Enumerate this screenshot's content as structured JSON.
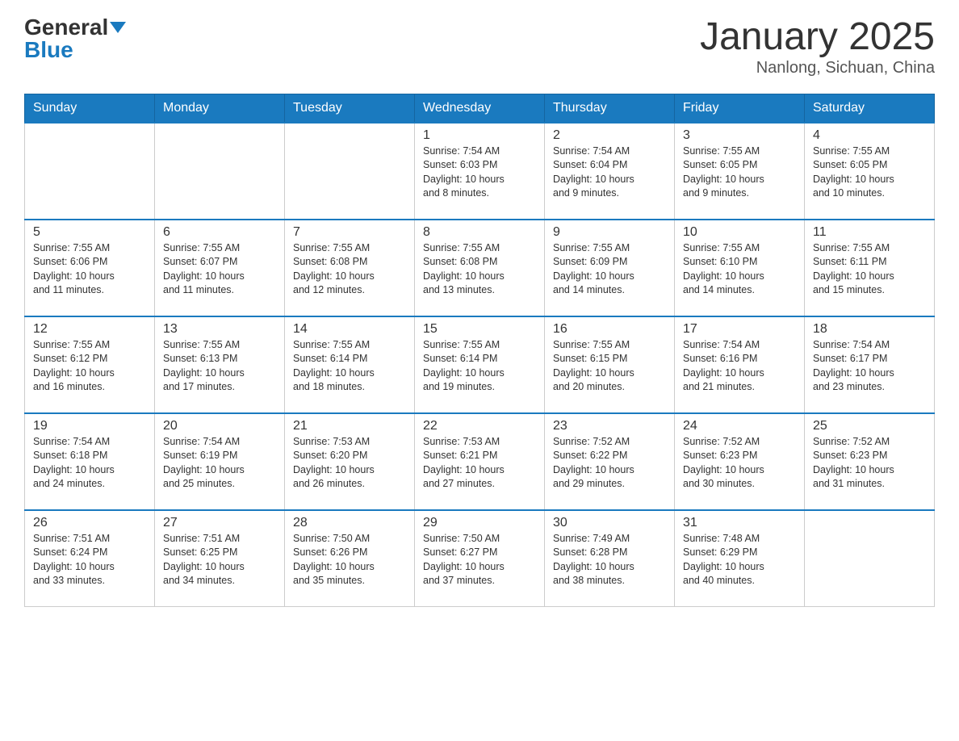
{
  "header": {
    "logo_general": "General",
    "logo_blue": "Blue",
    "title": "January 2025",
    "subtitle": "Nanlong, Sichuan, China"
  },
  "calendar": {
    "days_of_week": [
      "Sunday",
      "Monday",
      "Tuesday",
      "Wednesday",
      "Thursday",
      "Friday",
      "Saturday"
    ],
    "weeks": [
      [
        {
          "day": "",
          "info": ""
        },
        {
          "day": "",
          "info": ""
        },
        {
          "day": "",
          "info": ""
        },
        {
          "day": "1",
          "info": "Sunrise: 7:54 AM\nSunset: 6:03 PM\nDaylight: 10 hours\nand 8 minutes."
        },
        {
          "day": "2",
          "info": "Sunrise: 7:54 AM\nSunset: 6:04 PM\nDaylight: 10 hours\nand 9 minutes."
        },
        {
          "day": "3",
          "info": "Sunrise: 7:55 AM\nSunset: 6:05 PM\nDaylight: 10 hours\nand 9 minutes."
        },
        {
          "day": "4",
          "info": "Sunrise: 7:55 AM\nSunset: 6:05 PM\nDaylight: 10 hours\nand 10 minutes."
        }
      ],
      [
        {
          "day": "5",
          "info": "Sunrise: 7:55 AM\nSunset: 6:06 PM\nDaylight: 10 hours\nand 11 minutes."
        },
        {
          "day": "6",
          "info": "Sunrise: 7:55 AM\nSunset: 6:07 PM\nDaylight: 10 hours\nand 11 minutes."
        },
        {
          "day": "7",
          "info": "Sunrise: 7:55 AM\nSunset: 6:08 PM\nDaylight: 10 hours\nand 12 minutes."
        },
        {
          "day": "8",
          "info": "Sunrise: 7:55 AM\nSunset: 6:08 PM\nDaylight: 10 hours\nand 13 minutes."
        },
        {
          "day": "9",
          "info": "Sunrise: 7:55 AM\nSunset: 6:09 PM\nDaylight: 10 hours\nand 14 minutes."
        },
        {
          "day": "10",
          "info": "Sunrise: 7:55 AM\nSunset: 6:10 PM\nDaylight: 10 hours\nand 14 minutes."
        },
        {
          "day": "11",
          "info": "Sunrise: 7:55 AM\nSunset: 6:11 PM\nDaylight: 10 hours\nand 15 minutes."
        }
      ],
      [
        {
          "day": "12",
          "info": "Sunrise: 7:55 AM\nSunset: 6:12 PM\nDaylight: 10 hours\nand 16 minutes."
        },
        {
          "day": "13",
          "info": "Sunrise: 7:55 AM\nSunset: 6:13 PM\nDaylight: 10 hours\nand 17 minutes."
        },
        {
          "day": "14",
          "info": "Sunrise: 7:55 AM\nSunset: 6:14 PM\nDaylight: 10 hours\nand 18 minutes."
        },
        {
          "day": "15",
          "info": "Sunrise: 7:55 AM\nSunset: 6:14 PM\nDaylight: 10 hours\nand 19 minutes."
        },
        {
          "day": "16",
          "info": "Sunrise: 7:55 AM\nSunset: 6:15 PM\nDaylight: 10 hours\nand 20 minutes."
        },
        {
          "day": "17",
          "info": "Sunrise: 7:54 AM\nSunset: 6:16 PM\nDaylight: 10 hours\nand 21 minutes."
        },
        {
          "day": "18",
          "info": "Sunrise: 7:54 AM\nSunset: 6:17 PM\nDaylight: 10 hours\nand 23 minutes."
        }
      ],
      [
        {
          "day": "19",
          "info": "Sunrise: 7:54 AM\nSunset: 6:18 PM\nDaylight: 10 hours\nand 24 minutes."
        },
        {
          "day": "20",
          "info": "Sunrise: 7:54 AM\nSunset: 6:19 PM\nDaylight: 10 hours\nand 25 minutes."
        },
        {
          "day": "21",
          "info": "Sunrise: 7:53 AM\nSunset: 6:20 PM\nDaylight: 10 hours\nand 26 minutes."
        },
        {
          "day": "22",
          "info": "Sunrise: 7:53 AM\nSunset: 6:21 PM\nDaylight: 10 hours\nand 27 minutes."
        },
        {
          "day": "23",
          "info": "Sunrise: 7:52 AM\nSunset: 6:22 PM\nDaylight: 10 hours\nand 29 minutes."
        },
        {
          "day": "24",
          "info": "Sunrise: 7:52 AM\nSunset: 6:23 PM\nDaylight: 10 hours\nand 30 minutes."
        },
        {
          "day": "25",
          "info": "Sunrise: 7:52 AM\nSunset: 6:23 PM\nDaylight: 10 hours\nand 31 minutes."
        }
      ],
      [
        {
          "day": "26",
          "info": "Sunrise: 7:51 AM\nSunset: 6:24 PM\nDaylight: 10 hours\nand 33 minutes."
        },
        {
          "day": "27",
          "info": "Sunrise: 7:51 AM\nSunset: 6:25 PM\nDaylight: 10 hours\nand 34 minutes."
        },
        {
          "day": "28",
          "info": "Sunrise: 7:50 AM\nSunset: 6:26 PM\nDaylight: 10 hours\nand 35 minutes."
        },
        {
          "day": "29",
          "info": "Sunrise: 7:50 AM\nSunset: 6:27 PM\nDaylight: 10 hours\nand 37 minutes."
        },
        {
          "day": "30",
          "info": "Sunrise: 7:49 AM\nSunset: 6:28 PM\nDaylight: 10 hours\nand 38 minutes."
        },
        {
          "day": "31",
          "info": "Sunrise: 7:48 AM\nSunset: 6:29 PM\nDaylight: 10 hours\nand 40 minutes."
        },
        {
          "day": "",
          "info": ""
        }
      ]
    ]
  }
}
